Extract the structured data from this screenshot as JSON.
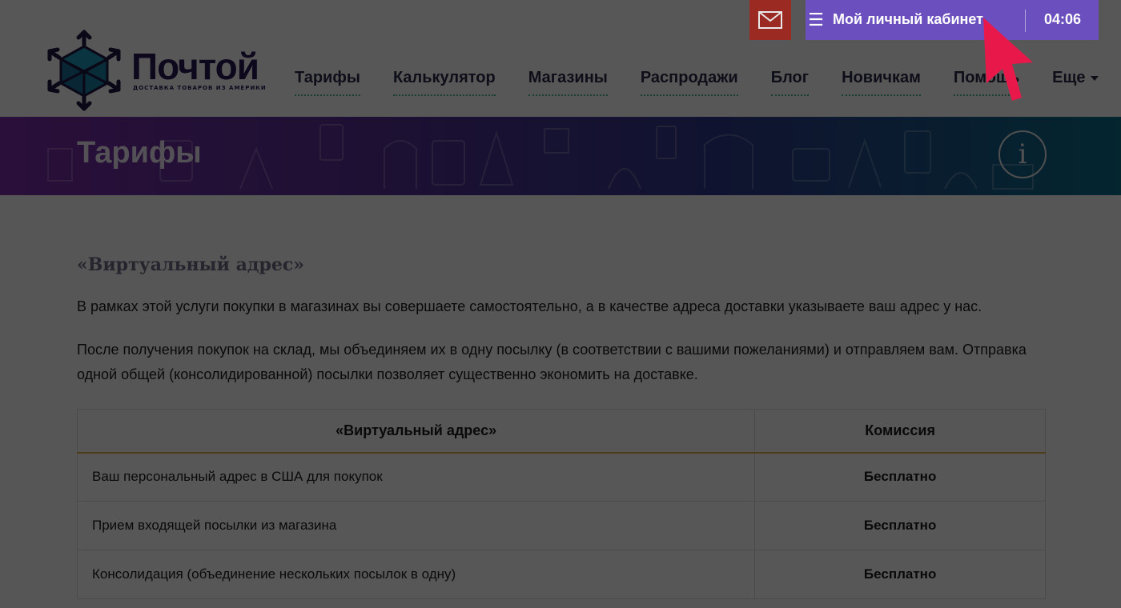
{
  "logo": {
    "name": "Почтой",
    "tagline": "ДОСТАВКА ТОВАРОВ ИЗ АМЕРИКИ"
  },
  "nav": {
    "items": [
      {
        "label": "Тарифы"
      },
      {
        "label": "Калькулятор"
      },
      {
        "label": "Магазины"
      },
      {
        "label": "Распродажи"
      },
      {
        "label": "Блог"
      },
      {
        "label": "Новичкам"
      },
      {
        "label": "Помощь"
      },
      {
        "label": "Еще"
      }
    ]
  },
  "topbar": {
    "mail_icon": "envelope-icon",
    "menu_icon": "hamburger-icon",
    "cabinet_label": "Мой личный кабинет",
    "timer": "04:06"
  },
  "banner": {
    "title": "Тарифы",
    "info_icon": "info-icon"
  },
  "section": {
    "title": "«Виртуальный адрес»",
    "paragraphs": [
      "В рамках этой услуги покупки в магазинах вы совершаете самостоятельно, а в качестве адреса доставки указываете ваш адрес у нас.",
      "После получения покупок на склад, мы объединяем их в одну посылку (в соответствии с вашими пожеланиями) и отправляем вам. Отправка одной общей (консолидированной) посылки позволяет существенно экономить на доставке."
    ]
  },
  "table": {
    "headers": [
      "«Виртуальный адрес»",
      "Комиссия"
    ],
    "rows": [
      [
        "Ваш персональный адрес в США для покупок",
        "Бесплатно"
      ],
      [
        "Прием входящей посылки из магазина",
        "Бесплатно"
      ],
      [
        "Консолидация (объединение нескольких посылок в одну)",
        "Бесплатно"
      ]
    ]
  },
  "colors": {
    "overlay": "rgba(0,0,0,0.66)",
    "cabinet_bg": "#6b4fbf",
    "mail_bg": "#9b2a23",
    "cursor": "#e8194a",
    "table_header_accent": "#e3b04b"
  }
}
